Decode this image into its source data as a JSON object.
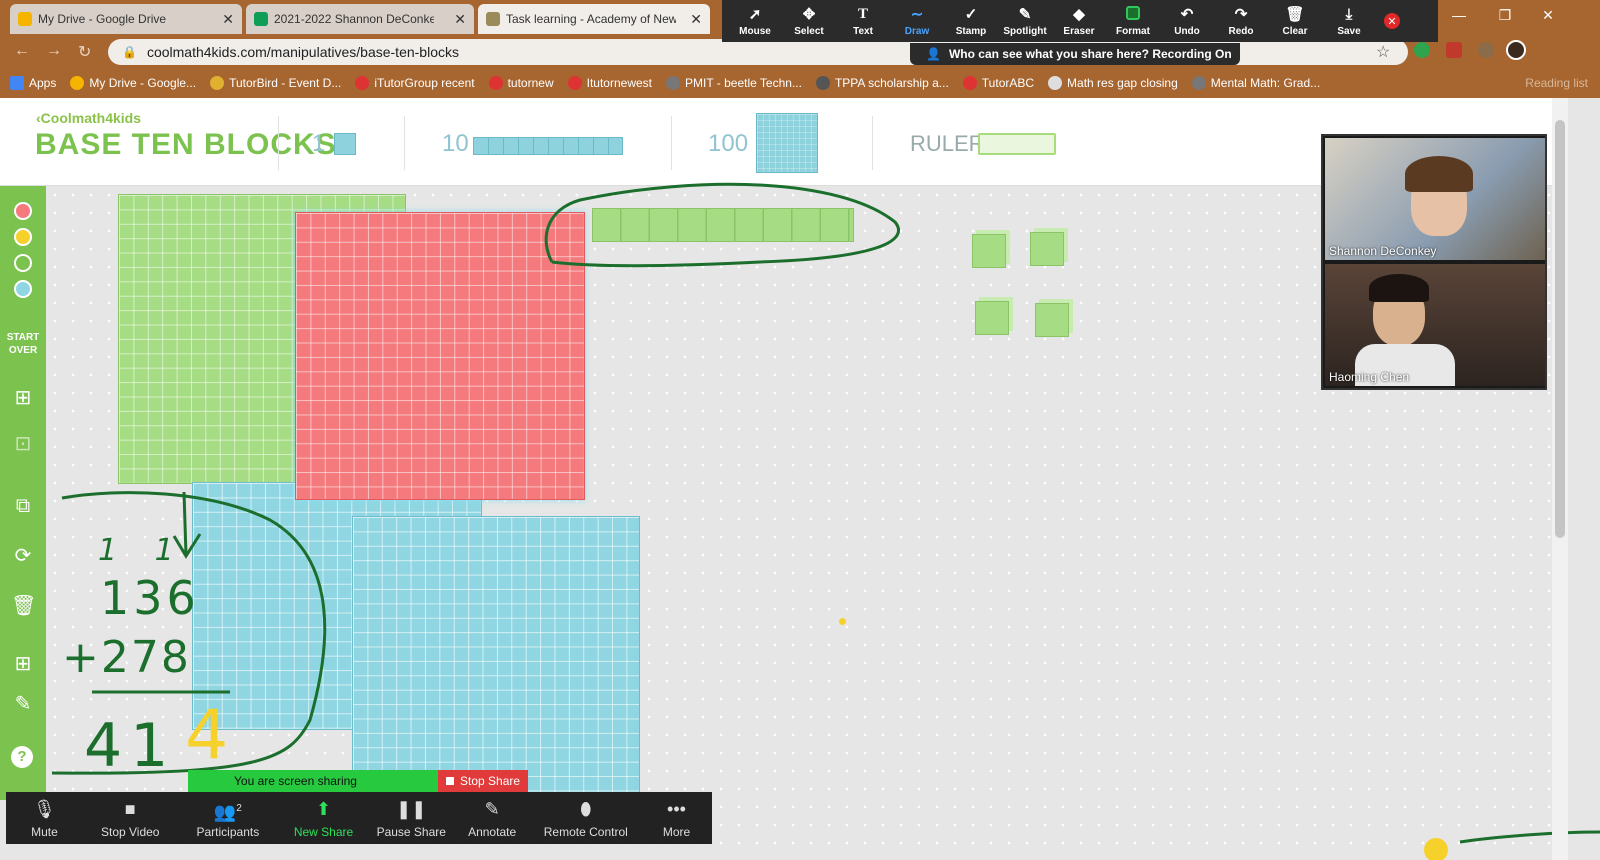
{
  "browser": {
    "tabs": [
      {
        "title": "My Drive - Google Drive",
        "active": false
      },
      {
        "title": "2021-2022 Shannon DeConkey -",
        "active": false
      },
      {
        "title": "Task learning - Academy of New",
        "active": true
      }
    ],
    "url": "coolmath4kids.com/manipulatives/base-ten-blocks",
    "bookmarks": [
      "Apps",
      "My Drive - Google...",
      "TutorBird - Event D...",
      "iTutorGroup recent",
      "tutornew",
      "Itutornewest",
      "PMIT - beetle Techn...",
      "TPPA scholarship a...",
      "TutorABC",
      "Math res gap closing",
      "Mental Math: Grad..."
    ],
    "reading_list": "Reading list"
  },
  "annotate_toolbar": {
    "tools": [
      "Mouse",
      "Select",
      "Text",
      "Draw",
      "Stamp",
      "Spotlight",
      "Eraser",
      "Format",
      "Undo",
      "Redo",
      "Clear",
      "Save"
    ],
    "active_tool": "Draw",
    "share_notice": "Who can see what you share here? Recording On"
  },
  "app": {
    "logo_small": "Coolmath4kids",
    "title": "BASE TEN BLOCKS",
    "blocks": [
      "1",
      "10",
      "100"
    ],
    "ruler_label": "RULER",
    "start_over": "START OVER"
  },
  "participants": [
    {
      "name": "Shannon DeConkey"
    },
    {
      "name": "Haoming Chen"
    }
  ],
  "handwriting": {
    "carries": "1 1",
    "addend1": "136",
    "addend2": "+278",
    "sum": "414",
    "ink_color": "#1b6e2c",
    "highlight_color": "#f7d12b"
  },
  "zoom": {
    "sharing_label": "You are screen sharing",
    "stop_share": "Stop Share",
    "buttons": [
      "Mute",
      "Stop Video",
      "Participants",
      "New Share",
      "Pause Share",
      "Annotate",
      "Remote Control",
      "More"
    ],
    "participants_count": "2"
  },
  "colors": {
    "green": "#7cc24f",
    "red_block": "#f47a7d",
    "blue_block": "#8fd6e2",
    "browser": "#a7652f"
  }
}
